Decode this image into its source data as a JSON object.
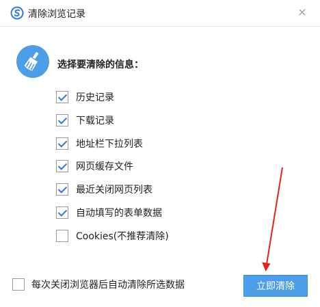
{
  "window": {
    "title": "清除浏览记录",
    "close_glyph": "×",
    "logo_icon": "sogou-s-logo-icon"
  },
  "section": {
    "heading": "选择要清除的信息：",
    "icon": "broom-icon"
  },
  "options": [
    {
      "label": "历史记录",
      "checked": true
    },
    {
      "label": "下载记录",
      "checked": true
    },
    {
      "label": "地址栏下拉列表",
      "checked": true
    },
    {
      "label": "网页缓存文件",
      "checked": true
    },
    {
      "label": "最近关闭网页列表",
      "checked": true
    },
    {
      "label": "自动填写的表单数据",
      "checked": true
    },
    {
      "label": "Cookies(不推荐清除)",
      "checked": false
    }
  ],
  "footer": {
    "auto_clear_label": "每次关闭浏览器后自动清除所选数据",
    "auto_clear_checked": false,
    "primary_button_label": "立即清除"
  },
  "colors": {
    "accent": "#4d9ee8",
    "check": "#2c7cd6",
    "annotation_arrow": "#e8201c"
  }
}
